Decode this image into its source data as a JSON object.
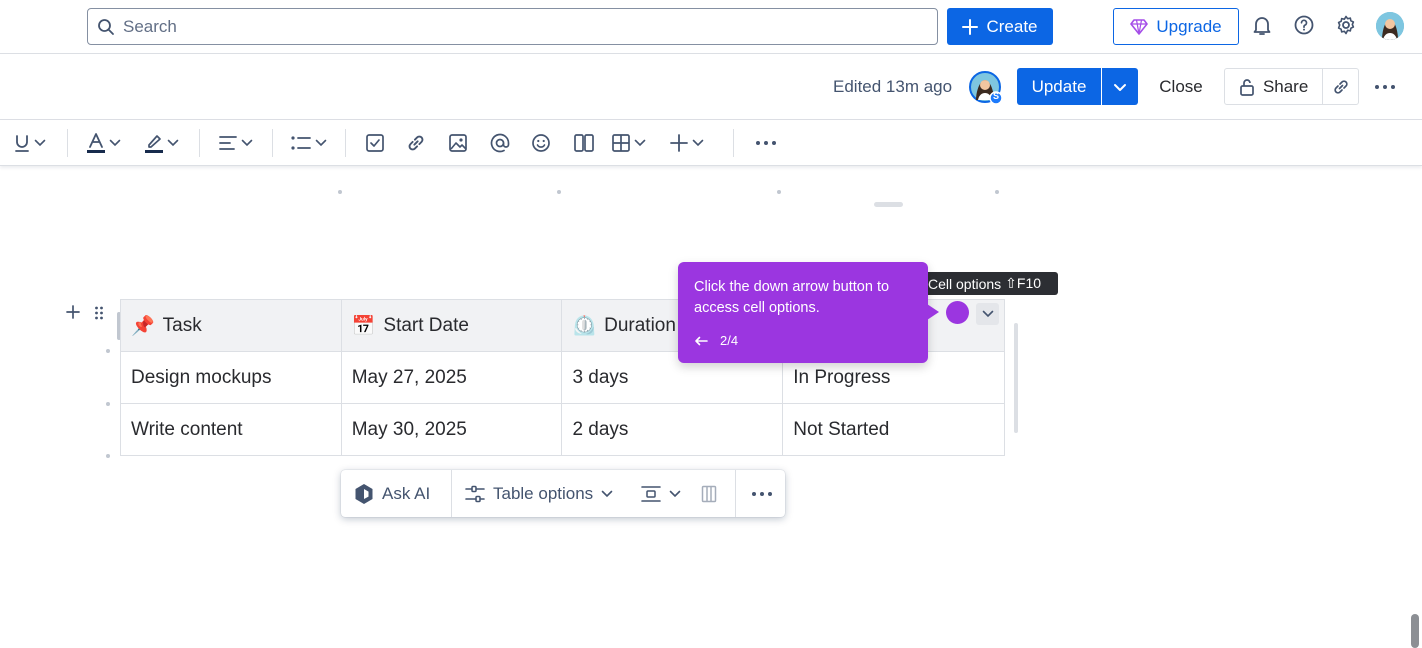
{
  "topbar": {
    "search_placeholder": "Search",
    "create_label": "Create",
    "upgrade_label": "Upgrade",
    "icons": [
      "search-icon",
      "plus-icon",
      "gem-icon",
      "bell-icon",
      "help-icon",
      "gear-icon"
    ]
  },
  "editbar": {
    "edited_text": "Edited 13m ago",
    "avatar_badge": "S",
    "update_label": "Update",
    "close_label": "Close",
    "share_label": "Share"
  },
  "toolbar": {
    "items": [
      "underline",
      "text-color",
      "highlight",
      "align",
      "bullet-list",
      "task",
      "link",
      "image",
      "mention",
      "emoji",
      "layouts",
      "table",
      "insert",
      "more"
    ]
  },
  "table": {
    "headers": [
      {
        "emoji": "📌",
        "label": "Task"
      },
      {
        "emoji": "📅",
        "label": "Start Date"
      },
      {
        "emoji": "⏲️",
        "label": "Duration"
      },
      {
        "emoji": "",
        "label": ""
      }
    ],
    "rows": [
      [
        "Design mockups",
        "May 27, 2025",
        "3 days",
        "In Progress"
      ],
      [
        "Write content",
        "May 30, 2025",
        "2 days",
        "Not Started"
      ]
    ]
  },
  "guide": {
    "message": "Click the down arrow button to access cell options.",
    "step": "2/4",
    "cell_options_label": "Cell options",
    "shortcut": "⇧F10"
  },
  "floating_toolbar": {
    "ask_ai_label": "Ask AI",
    "table_options_label": "Table options"
  },
  "colors": {
    "primary": "#0c66e4",
    "guide_purple": "#9b36e0",
    "header_bg": "#f1f2f4"
  }
}
